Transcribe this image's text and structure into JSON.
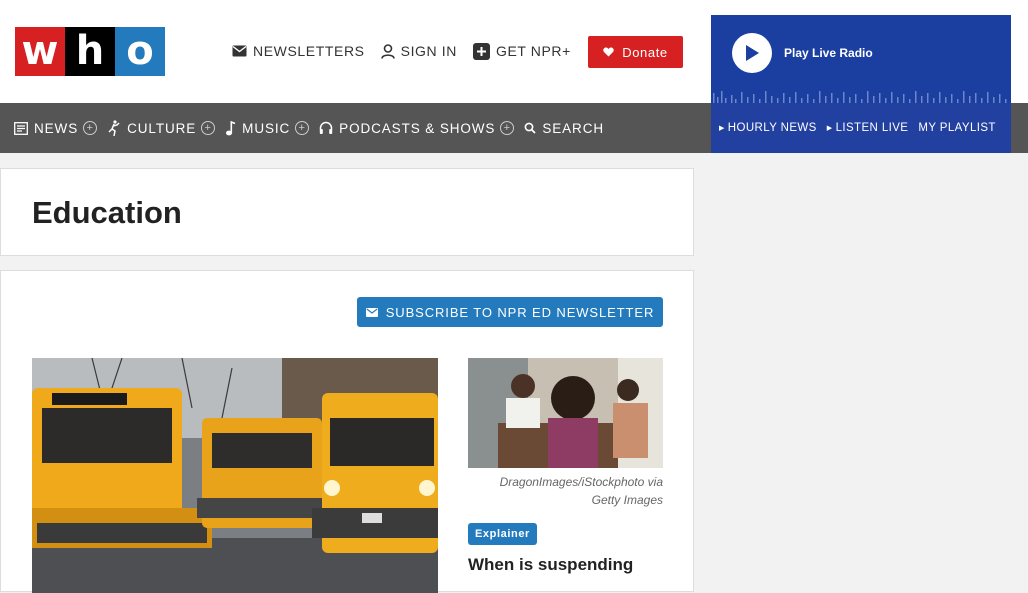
{
  "logo": {
    "letters": [
      "w",
      "h",
      "o"
    ]
  },
  "top_links": [
    {
      "label": "Newsletters",
      "icon": "mail-icon"
    },
    {
      "label": "Sign In",
      "icon": "user-icon"
    },
    {
      "label": "Get NPR+",
      "icon": "plus-square-icon"
    }
  ],
  "donate": {
    "label": "Donate",
    "icon": "heart-icon"
  },
  "player": {
    "play_label": "Play Live Radio",
    "links": [
      {
        "label": "Hourly News",
        "arrow": true
      },
      {
        "label": "Listen Live",
        "arrow": true
      },
      {
        "label": "My Playlist",
        "arrow": false
      }
    ]
  },
  "nav": [
    {
      "label": "News",
      "icon": "news-icon",
      "expand": true
    },
    {
      "label": "Culture",
      "icon": "culture-icon",
      "expand": true
    },
    {
      "label": "Music",
      "icon": "music-icon",
      "expand": true
    },
    {
      "label": "Podcasts & Shows",
      "icon": "headphones-icon",
      "expand": true
    },
    {
      "label": "Search",
      "icon": "search-icon",
      "expand": false
    }
  ],
  "page": {
    "title": "Education"
  },
  "subscribe": {
    "label": "Subscribe to NPR Ed Newsletter",
    "icon": "mail-icon"
  },
  "stories": {
    "lead": {
      "image_alt": "Yellow school buses parked on a street"
    },
    "secondary": {
      "image_alt": "A child sits with a parent across from an educator at a desk",
      "credit": "DragonImages/iStockphoto via Getty Images",
      "badge": "Explainer",
      "headline": "When is suspending"
    }
  },
  "colors": {
    "brand_red": "#d62021",
    "brand_blue": "#237bbd",
    "nav_gray": "#555555",
    "player_blue": "#1a3fa0"
  }
}
